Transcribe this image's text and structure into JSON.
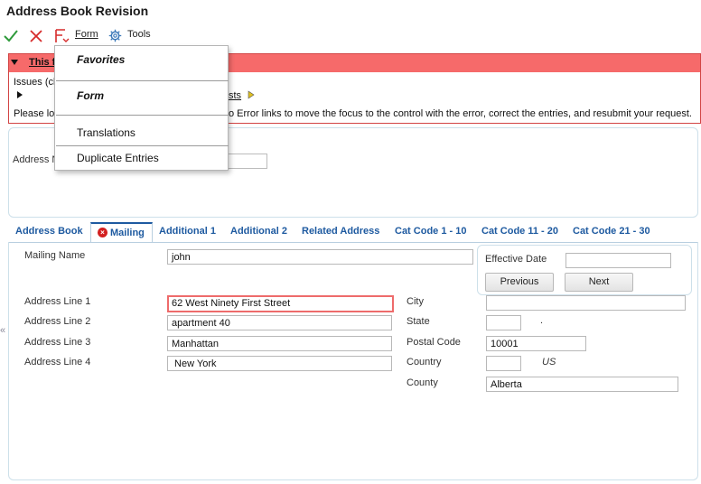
{
  "window": {
    "title": "Address Book Revision"
  },
  "toolbar": {
    "ok_icon": "checkmark-icon",
    "cancel_icon": "close-icon",
    "form_label": "Form",
    "tools_label": "Tools"
  },
  "error_panel": {
    "title": "This f",
    "issues_text": "Issues (cl",
    "link_fragment": "sts",
    "instructions": "Please lo",
    "instructions_tail": "o Error links to move the focus to the control with the error, correct the entries, and resubmit your request."
  },
  "menu": {
    "favorites": "Favorites",
    "form": "Form",
    "translations": "Translations",
    "duplicate_entries": "Duplicate Entries"
  },
  "header": {
    "address_number_label": "Address N"
  },
  "tabs": [
    {
      "label": "Address Book"
    },
    {
      "label": "Mailing",
      "active": true,
      "has_error": true
    },
    {
      "label": "Additional 1"
    },
    {
      "label": "Additional 2"
    },
    {
      "label": "Related Address"
    },
    {
      "label": "Cat Code 1 - 10"
    },
    {
      "label": "Cat Code 11 - 20"
    },
    {
      "label": "Cat Code 21 - 30"
    }
  ],
  "mailing": {
    "mailing_name_label": "Mailing Name",
    "mailing_name": "john",
    "address_line_1_label": "Address Line 1",
    "address_line_1": "62 West Ninety First Street",
    "address_line_2_label": "Address Line 2",
    "address_line_2": "apartment 40",
    "address_line_3_label": "Address Line 3",
    "address_line_3": "Manhattan",
    "address_line_4_label": "Address Line 4",
    "address_line_4": " New York",
    "city_label": "City",
    "city": "",
    "state_label": "State",
    "state": "",
    "state_desc": ".",
    "postal_code_label": "Postal Code",
    "postal_code": "10001",
    "country_label": "Country",
    "country": "",
    "country_desc": "US",
    "county_label": "County",
    "county": "Alberta"
  },
  "effective": {
    "label": "Effective Date",
    "value": "",
    "previous": "Previous",
    "next": "Next"
  },
  "colors": {
    "error_red": "#f66a6a",
    "tab_blue": "#1e5aa0"
  }
}
